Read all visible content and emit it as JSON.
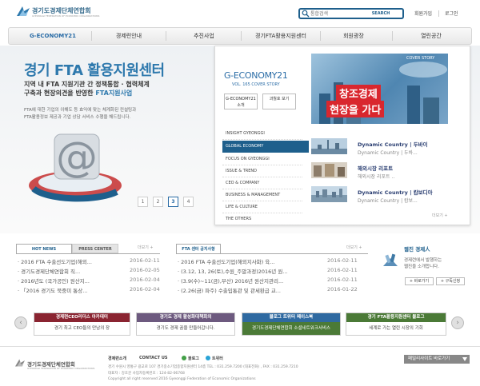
{
  "header": {
    "logo_name": "경기도경제단체연합회",
    "logo_sub": "GYEONGGI FEDERATION OF ECONOMIC ORGANIZATIONS",
    "search_placeholder": "통합검색",
    "search_button": "SEARCH",
    "join": "회원가입",
    "login": "로그인"
  },
  "gnb": {
    "items": [
      "G-ECONOMY21",
      "경제련안내",
      "추진사업",
      "경기FTA활용지원센터",
      "회원광장",
      "열린공간"
    ]
  },
  "hero": {
    "title": "경기 FTA 활용지원센터",
    "sub1": "지역 내 FTA 지원기관 간 정책통합 · 협력체계",
    "sub2_prefix": "구축과 현장의견을 반영한 ",
    "sub2_highlight": "FTA지원사업",
    "desc1": "FTA에 대한 기업의 이해도 등 효익에 맞는 체계화된 컨설팅과",
    "desc2": "FTA활용정보 제공과 기업 상담 서비스 수행을 해드립니다.",
    "pages": [
      "1",
      "2",
      "3",
      "4"
    ],
    "active_page": "3"
  },
  "magazine": {
    "logo": "G-ECONOMY21",
    "vol": "VOL. 165  COVER STORY",
    "intro_button": "G-ECONOMY21 소개",
    "past_button": "과월호 보기",
    "cover_story": "COVER STORY",
    "cover_text1": "창조경제",
    "cover_text2": "현장을 가다",
    "categories": [
      "INSIGHT GYEONGGI",
      "GLOBAL ECONOMY",
      "FOCUS ON GYEONGGI",
      "ISSUE & TREND",
      "CEO & COMPANY",
      "BUSINESS & MANAGEMENT",
      "LIFE & CULTURE",
      "THE OTHERS"
    ],
    "active_category": "GLOBAL ECONOMY",
    "articles": [
      {
        "title": "Dynamic Country | 두바이",
        "desc": "Dynamic Country | 두바..."
      },
      {
        "title": "해외시장 리포트",
        "desc": "해외시장 리포트 .."
      },
      {
        "title": "Dynamic Country | 캄보디아",
        "desc": "Dynamic Country | 캄보..."
      }
    ],
    "more": "더보기 +"
  },
  "news": {
    "tab_hot": "HOT NEWS",
    "tab_press": "PRESS CENTER",
    "more": "더보기 +",
    "items": [
      {
        "title": "· 2016 FTA 수출선도기업(해외...",
        "date": "2016-02-11"
      },
      {
        "title": "· 경기도경제단체연합회 직...",
        "date": "2016-02-05"
      },
      {
        "title": "· 2016년도 (국가공인) 원산지...",
        "date": "2016-02-04"
      },
      {
        "title": "· 「2016 경기도 북중미 통상...",
        "date": "2016-02-04"
      }
    ]
  },
  "fta_news": {
    "tab": "FTA 센터 공지사항",
    "more": "더보기 +",
    "items": [
      {
        "title": "· 2016 FTA 수출선도기업(해외지사화) 육...",
        "date": "2016-02-11"
      },
      {
        "title": "· (3.12, 13, 26(토),수원_주말과정)2016년 원...",
        "date": "2016-02-11"
      },
      {
        "title": "· (3.9(수)~11(금),부산) 2016년 원산지관리...",
        "date": "2016-02-11"
      },
      {
        "title": "· (2.26(금) 파주) 수출입통관 및 관세환급 교...",
        "date": "2016-01-22"
      }
    ]
  },
  "ebook": {
    "title": "웹진 경제人",
    "desc1": "경제련에서 발행하는",
    "desc2": "웹진을 소개합니다.",
    "view_button": "+ 바로가기",
    "subscribe_button": "+ 구독신청"
  },
  "banners": [
    {
      "top": "경제련CEO리더스 아카데미",
      "bottom": "경기 최고 CEO들의 만남의 장",
      "color": "#8a2431"
    },
    {
      "top": "경기도 경제 활성화대책회의",
      "bottom": "경기도 경제 꿈을 만들어갑니다.",
      "color": "#6d5a7f"
    },
    {
      "top": "블로그  트위터  페이스북",
      "bottom": "경기도경제단체연합회 소셜네트워크서비스",
      "color": "#2f6aa1"
    },
    {
      "top": "경기 FTA활용지원센터 블로그",
      "bottom": "세계로 가는 열린 시장의 기회",
      "color": "#4b7a37"
    }
  ],
  "footer": {
    "logo_name": "경기도경제단체연합회",
    "logo_sub": "GYEONGGI FEDERATION OF ECONOMIC ORGANIZATIONS",
    "links": [
      "경제련소개",
      "CONTACT US",
      "블로그",
      "트위터"
    ],
    "address": "경기 수원시 영통구 광교로 107 경기중소기업종합지원센터 14층  TEL : 031.259.7200 (대표전화) , FAX : 031.259.7210",
    "ceo": "대표자 : 강호문    사업자등록번호 : 124-82-06768",
    "copyright": "Copyright all right reserved 2016 Gyeonggi Federation of Economic Organizations",
    "family_site": "패밀리사이트 바로가기"
  },
  "colors": {
    "brand_blue": "#1e5f8c",
    "accent_blue": "#2e79ad",
    "accent_red": "#d9272e"
  }
}
